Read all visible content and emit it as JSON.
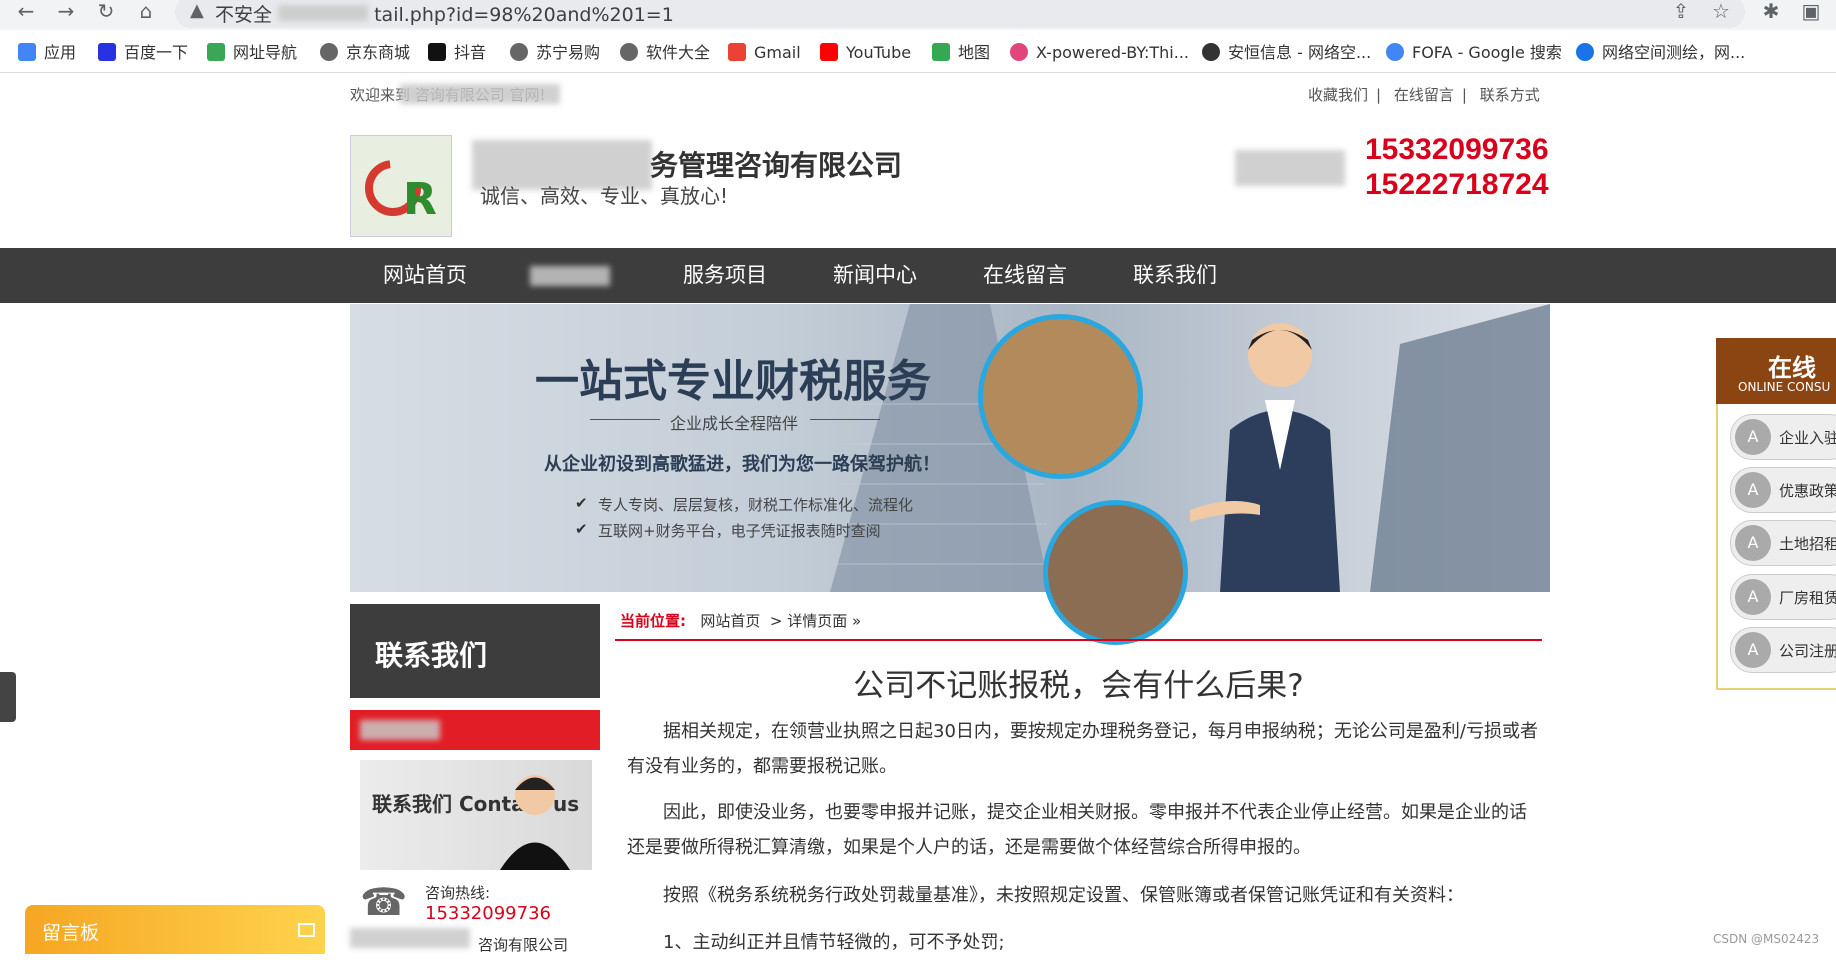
{
  "browser": {
    "security_label": "不安全",
    "url_tail": "tail.php?id=98%20and%201=1",
    "bookmarks": [
      {
        "label": "应用",
        "color": "#4285f4"
      },
      {
        "label": "百度一下",
        "color": "#2932e1"
      },
      {
        "label": "网址导航",
        "color": "#3aa757"
      },
      {
        "label": "京东商城",
        "color": "#666666"
      },
      {
        "label": "抖音",
        "color": "#111111"
      },
      {
        "label": "苏宁易购",
        "color": "#666666"
      },
      {
        "label": "软件大全",
        "color": "#666666"
      },
      {
        "label": "Gmail",
        "color": "#ea4335"
      },
      {
        "label": "YouTube",
        "color": "#ff0000"
      },
      {
        "label": "地图",
        "color": "#34a853"
      },
      {
        "label": "X-powered-BY:Thi...",
        "color": "#e0457b"
      },
      {
        "label": "安恒信息 - 网络空...",
        "color": "#333333"
      },
      {
        "label": "FOFA - Google 搜索",
        "color": "#4285f4"
      },
      {
        "label": "网络空间测绘，网...",
        "color": "#1a73e8"
      }
    ]
  },
  "site": {
    "welcome": "欢迎来到        咨询有限公司 官网!",
    "top_links": [
      "收藏我们",
      "在线留言",
      "联系方式"
    ],
    "company_name": "务管理咨询有限公司",
    "slogan": "诚信、高效、专业、真放心!",
    "phone1": "15332099736",
    "phone2": "15222718724",
    "nav": [
      "网站首页",
      "",
      "服务项目",
      "新闻中心",
      "在线留言",
      "联系我们"
    ]
  },
  "banner": {
    "title": "一站式专业财税服务",
    "subtitle": "企业成长全程陪伴",
    "slogan": "从企业初设到高歌猛进，我们为您一路保驾护航！",
    "checks": [
      "专人专岗、层层复核，财税工作标准化、流程化",
      "互联网+财务平台，电子凭证报表随时查阅"
    ]
  },
  "sidebar": {
    "contact_title": "联系我们",
    "contact_img_text": "联系我们 Contact us",
    "hotline_label": "咨询热线:",
    "hotline": "15332099736",
    "address": "咨询有限公司"
  },
  "article": {
    "crumb_label": "当前位置:",
    "crumb_home": "网站首页",
    "crumb_current": "详情页面 »",
    "title": "公司不记账报税，会有什么后果?",
    "paragraphs": [
      "据相关规定，在领营业执照之日起30日内，要按规定办理税务登记，每月申报纳税；无论公司是盈利/亏损或者有没有业务的，都需要报税记账。",
      "因此，即使没业务，也要零申报并记账，提交企业相关财报。零申报并不代表企业停止经营。如果是企业的话还是要做所得税汇算清缴，如果是个人户的话，还是需要做个体经营综合所得申报的。",
      "按照《税务系统税务行政处罚裁量基准》，未按照规定设置、保管账簿或者保管记账凭证和有关资料：",
      "1、主动纠正并且情节轻微的，可不予处罚;"
    ]
  },
  "float_panel": {
    "title": "在线",
    "subtitle": "ONLINE CONSU",
    "items": [
      "企业入驻",
      "优惠政策",
      "土地招租",
      "厂房租赁",
      "公司注册"
    ]
  },
  "message_board": {
    "label": "留言板"
  },
  "watermark": "CSDN @MS02423"
}
